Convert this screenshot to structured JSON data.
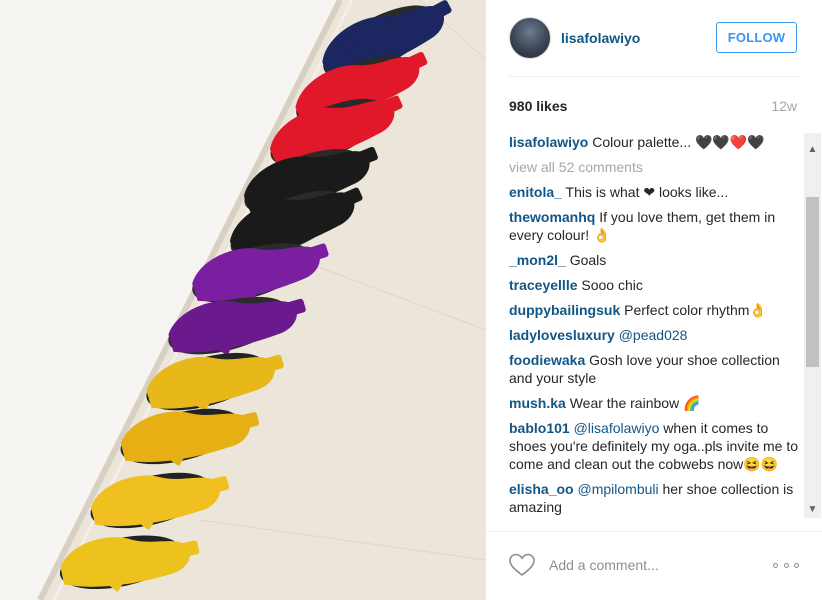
{
  "post": {
    "username": "lisafolawiyo",
    "follow_label": "FOLLOW",
    "likes": "980 likes",
    "age": "12w",
    "caption": {
      "user": "lisafolawiyo",
      "text": "Colour palette... 🖤🖤❤️🖤"
    },
    "view_all": "view all 52 comments",
    "comments": [
      {
        "user": "enitola_",
        "text": "This is what ❤ looks like..."
      },
      {
        "user": "thewomanhq",
        "text": "If you love them, get them in every colour! 👌"
      },
      {
        "user": "_mon2l_",
        "text": "Goals"
      },
      {
        "user": "traceyellle",
        "text": "Sooo chic"
      },
      {
        "user": "duppybailingsuk",
        "text": "Perfect color rhythm👌"
      },
      {
        "user": "ladylovesluxury",
        "mention": "@pead028",
        "text": ""
      },
      {
        "user": "foodiewaka",
        "text": "Gosh love your shoe collection and your style"
      },
      {
        "user": "mush.ka",
        "text": "Wear the rainbow 🌈"
      },
      {
        "user": "bablo101",
        "mention": "@lisafolawiyo",
        "text": " when it comes to shoes you're definitely my oga..pls invite me to come and clean out the cobwebs now😆😆"
      },
      {
        "user": "elisha_oo",
        "mention": "@mpilombuli",
        "text": " her shoe collection is amazing"
      }
    ],
    "add_comment_placeholder": "Add a comment..."
  },
  "icons": {
    "like": "heart-outline-icon",
    "more": "more-options-icon",
    "scroll_up": "scroll-up-arrow-icon",
    "scroll_down": "scroll-down-arrow-icon"
  },
  "photo": {
    "subject": "rainbow row of heeled shoes",
    "shoe_colors": [
      "#1c2660",
      "#e0182a",
      "#e0182a",
      "#1a1a1a",
      "#1a1a1a",
      "#7a1fa0",
      "#6a1a8c",
      "#e8b81a",
      "#e6b015",
      "#f0c020",
      "#ecc21c"
    ]
  },
  "colors": {
    "link": "#125688",
    "follow": "#3897f0",
    "muted": "#a5a7aa"
  }
}
